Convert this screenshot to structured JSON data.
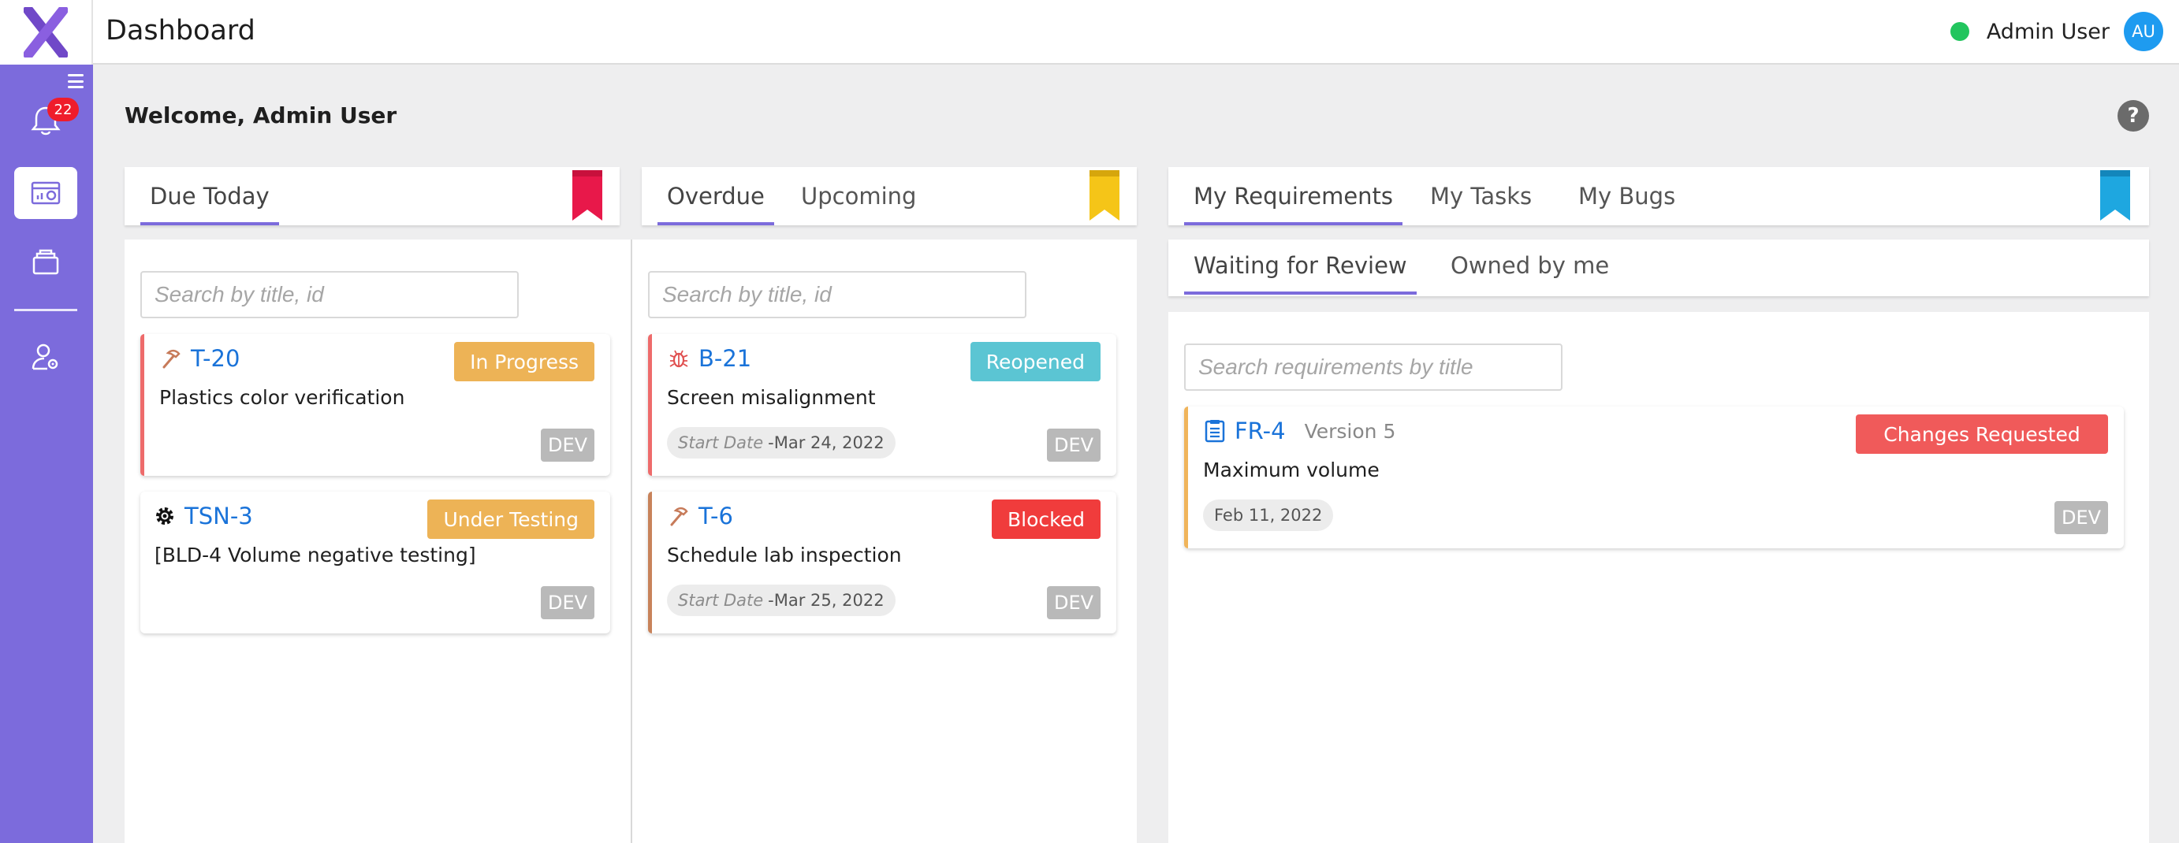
{
  "app": {
    "title": "Dashboard"
  },
  "header": {
    "user_name": "Admin User",
    "avatar_initials": "AU",
    "status_color": "#22c55e"
  },
  "sidebar": {
    "notification_count": "22",
    "accent": "#7c6bdc"
  },
  "welcome": "Welcome, Admin User",
  "panel_due": {
    "tabs": [
      "Due Today"
    ],
    "search_placeholder": "Search by title, id",
    "cards": [
      {
        "icon": "hammer-icon",
        "id": "T-20",
        "status": "In Progress",
        "status_color": "#edb356",
        "title": "Plastics color verification",
        "tag": "DEV",
        "bar_color": "#ee6b6b"
      },
      {
        "icon": "gear-icon",
        "id": "TSN-3",
        "status": "Under Testing",
        "status_color": "#edb356",
        "title": "[BLD-4 Volume negative testing]",
        "tag": "DEV",
        "bar_color": ""
      }
    ]
  },
  "panel_overdue": {
    "tabs": [
      "Overdue",
      "Upcoming"
    ],
    "search_placeholder": "Search by title, id",
    "cards": [
      {
        "icon": "bug-icon",
        "id": "B-21",
        "status": "Reopened",
        "status_color": "#5bc5d3",
        "title": "Screen misalignment",
        "date_label": "Start Date",
        "date_sep": " - ",
        "date": "Mar 24, 2022",
        "tag": "DEV",
        "bar_color": "#ee6b6b"
      },
      {
        "icon": "hammer-icon",
        "id": "T-6",
        "status": "Blocked",
        "status_color": "#f03c3c",
        "title": "Schedule lab inspection",
        "date_label": "Start Date",
        "date_sep": " - ",
        "date": "Mar 25, 2022",
        "tag": "DEV",
        "bar_color": "#c8835a"
      }
    ]
  },
  "panel_mine": {
    "tabs": [
      "My Requirements",
      "My Tasks",
      "My Bugs"
    ],
    "subtabs": [
      "Waiting for Review",
      "Owned by me"
    ],
    "search_placeholder": "Search requirements by title",
    "cards": [
      {
        "icon": "document-icon",
        "id": "FR-4",
        "version": "Version 5",
        "status": "Changes Requested",
        "status_color": "#f05a5a",
        "title": "Maximum volume",
        "date": "Feb 11, 2022",
        "tag": "DEV",
        "bar_color": "#f0b45a"
      }
    ]
  }
}
